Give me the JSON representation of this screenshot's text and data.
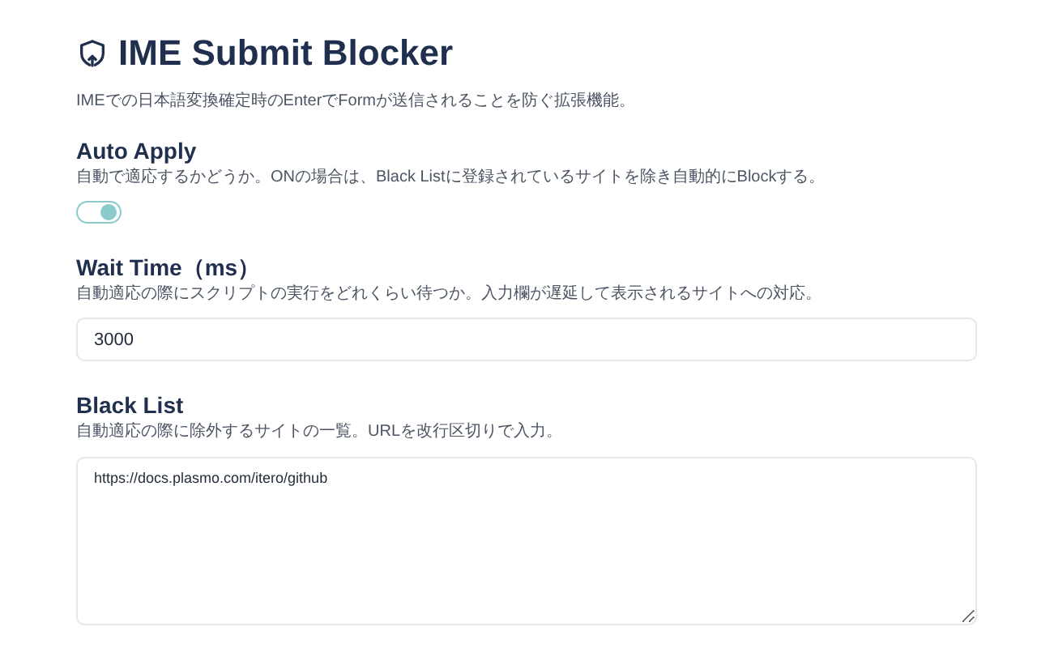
{
  "header": {
    "title": "IME Submit Blocker",
    "description": "IMEでの日本語変換確定時のEnterでFormが送信されることを防ぐ拡張機能。"
  },
  "settings": [
    {
      "kind": "toggle",
      "label": "Auto Apply",
      "description": "自動で適応するかどうか。ONの場合は、Black Listに登録されているサイトを除き自動的にBlockする。",
      "on": true
    },
    {
      "kind": "input",
      "label": "Wait Time（ms）",
      "description": "自動適応の際にスクリプトの実行をどれくらい待つか。入力欄が遅延して表示されるサイトへの対応。",
      "value": "3000"
    },
    {
      "kind": "textarea",
      "label": "Black List",
      "description": "自動適応の際に除外するサイトの一覧。URLを改行区切りで入力。",
      "value": "https://docs.plasmo.com/itero/github"
    }
  ]
}
